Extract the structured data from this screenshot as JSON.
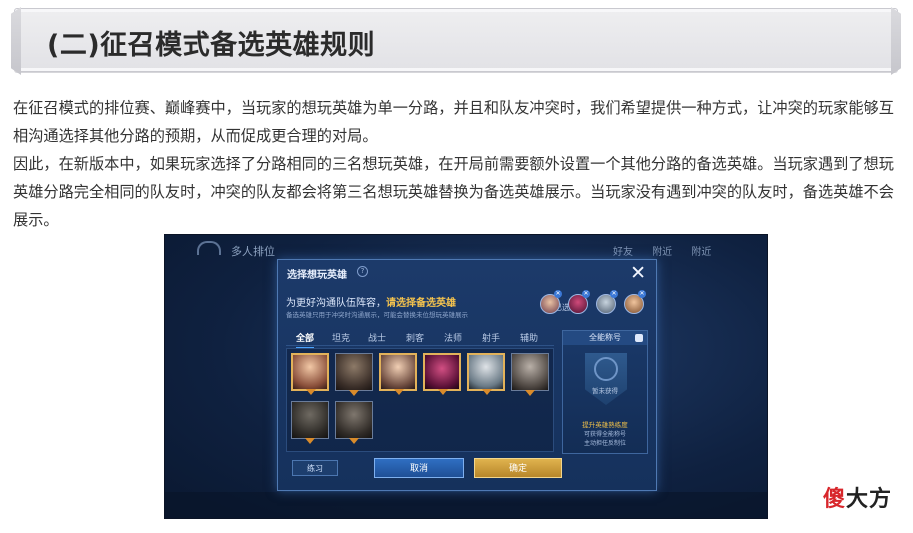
{
  "header": {
    "title": "(二)征召模式备选英雄规则"
  },
  "paragraphs": {
    "p1": "在征召模式的排位赛、巅峰赛中，当玩家的想玩英雄为单一分路，并且和队友冲突时，我们希望提供一种方式，让冲突的玩家能够互相沟通选择其他分路的预期，从而促成更合理的对局。",
    "p2": "因此，在新版本中，如果玩家选择了分路相同的三名想玩英雄，在开局前需要额外设置一个其他分路的备选英雄。当玩家遇到了想玩英雄分路完全相同的队友时，冲突的队友都会将第三名想玩英雄替换为备选英雄展示。当玩家没有遇到冲突的队友时，备选英雄不会展示。"
  },
  "game": {
    "top_title": "多人排位",
    "top_tabs": [
      "好友",
      "附近",
      "附近"
    ],
    "dialog": {
      "title": "选择想玩英雄",
      "help": "?",
      "close": "✕",
      "headline_prefix": "为更好沟通队伍阵容，",
      "headline_highlight": "请选择备选英雄",
      "subline": "备选英雄只用于冲突时沟通展示，可能会替换未位想玩英雄展示",
      "selected_label": "已选：",
      "role_tabs": [
        "全部",
        "坦克",
        "战士",
        "刺客",
        "法师",
        "射手",
        "辅助"
      ],
      "title_panel": {
        "heading": "全能称号",
        "unavailable": "暂未获得",
        "foot1": "提升英雄熟练度",
        "foot2": "可获得全能称号",
        "foot3": "主动担任反制位"
      },
      "buttons": {
        "practice": "练习",
        "cancel": "取消",
        "confirm": "确定"
      }
    },
    "colors": {
      "accent_gold": "#f3c24e",
      "accent_blue": "#4aa3ff"
    }
  },
  "watermark": {
    "part1": "傻",
    "part2": "大方"
  }
}
